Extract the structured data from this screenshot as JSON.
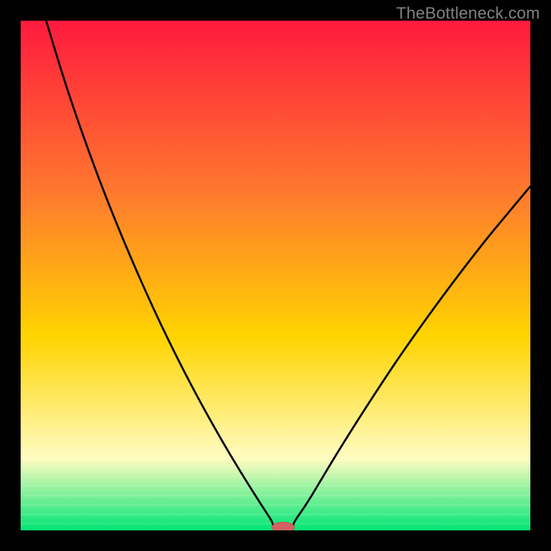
{
  "watermark": "TheBottleneck.com",
  "colors": {
    "frame": "#000000",
    "gradient_top": "#ff1a3e",
    "gradient_mid_upper": "#ff7a2e",
    "gradient_mid": "#ffd400",
    "gradient_lower": "#fffcc0",
    "gradient_bottom": "#00e574",
    "stroke": "#0a0a0a",
    "marker_fill": "#d26262",
    "marker_stroke": "#c85151"
  },
  "chart_data": {
    "type": "line",
    "title": "",
    "xlabel": "",
    "ylabel": "",
    "xlim": [
      0,
      100
    ],
    "ylim": [
      0,
      100
    ],
    "series": [
      {
        "name": "left-curve",
        "x": [
          5,
          8,
          11,
          14,
          17,
          20,
          23,
          26,
          29,
          32,
          35,
          38,
          41,
          44,
          46,
          48,
          49.5
        ],
        "y": [
          100,
          90,
          81,
          72.6,
          64.7,
          57.3,
          50.3,
          43.6,
          37.3,
          31.3,
          25.6,
          20.2,
          15.0,
          10.1,
          6.9,
          3.8,
          1.5
        ]
      },
      {
        "name": "floor-segment",
        "x": [
          49.5,
          53.5
        ],
        "y": [
          0.6,
          0.6
        ]
      },
      {
        "name": "right-curve",
        "x": [
          53.5,
          56,
          59,
          62,
          65,
          68,
          71,
          74,
          77,
          80,
          83,
          86,
          89,
          92,
          95,
          98,
          100
        ],
        "y": [
          1.5,
          5.0,
          10.0,
          15.0,
          19.8,
          24.5,
          29.1,
          33.6,
          37.9,
          42.1,
          46.2,
          50.2,
          54.1,
          57.9,
          61.5,
          65.1,
          67.5
        ]
      }
    ],
    "marker": {
      "name": "bottleneck-marker",
      "x_center": 51.5,
      "y_center": 0.6,
      "rx": 2.2,
      "ry": 1.0
    }
  }
}
